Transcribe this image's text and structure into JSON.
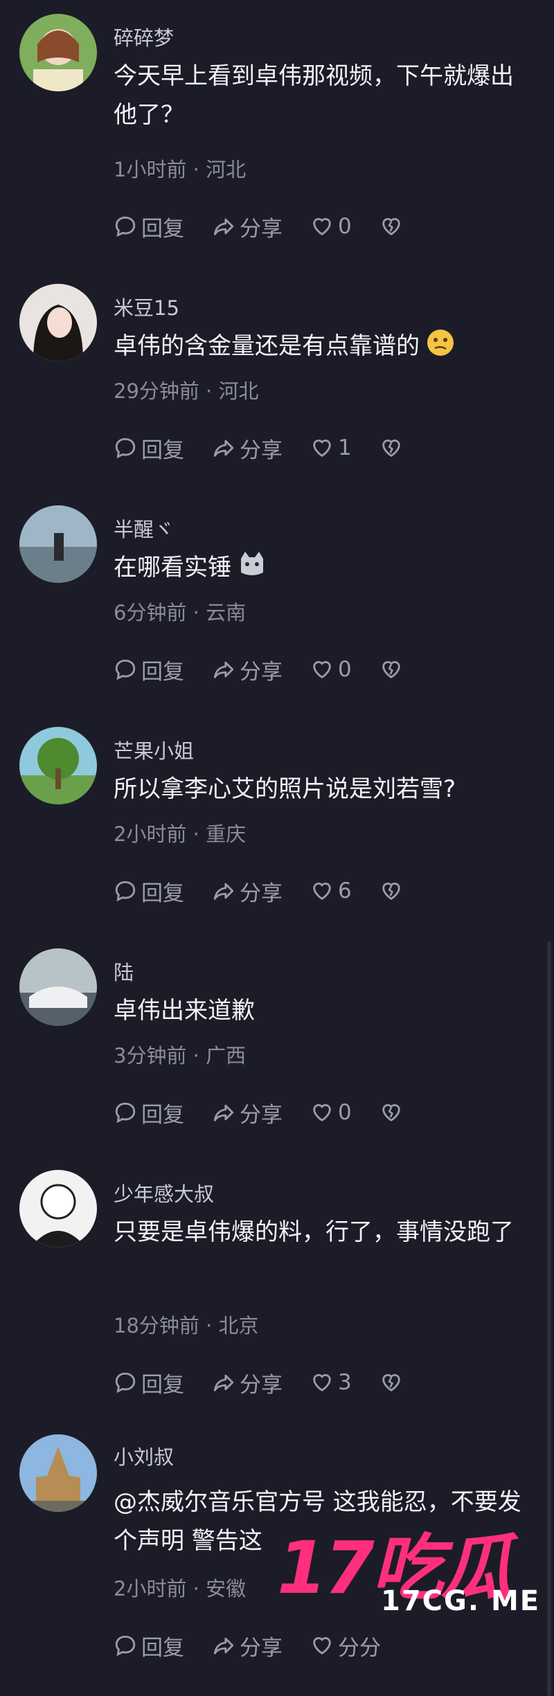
{
  "comments": [
    {
      "username": "碎碎梦",
      "text": "今天早上看到卓伟那视频，下午就爆出他了？",
      "meta": "1小时前 · 河北",
      "reply": "回复",
      "share": "分享",
      "likes": "0"
    },
    {
      "username": "米豆15",
      "text": "卓伟的含金量还是有点靠谱的",
      "meta": "29分钟前 · 河北",
      "reply": "回复",
      "share": "分享",
      "likes": "1",
      "emoji": "thinking-face-emoji"
    },
    {
      "username": "半醒ヾ",
      "text": "在哪看实锤",
      "meta": "6分钟前 · 云南",
      "reply": "回复",
      "share": "分享",
      "likes": "0",
      "emoji": "cat-face-emoji"
    },
    {
      "username": "芒果小姐",
      "text": "所以拿李心艾的照片说是刘若雪?",
      "meta": "2小时前 · 重庆",
      "reply": "回复",
      "share": "分享",
      "likes": "6"
    },
    {
      "username": "陆",
      "text": "卓伟出来道歉",
      "meta": "3分钟前 · 广西",
      "reply": "回复",
      "share": "分享",
      "likes": "0"
    },
    {
      "username": "少年感大叔",
      "text": "只要是卓伟爆的料，行了，事情没跑了",
      "meta": "18分钟前 · 北京",
      "reply": "回复",
      "share": "分享",
      "likes": "3"
    },
    {
      "username": "小刘叔",
      "text": "@杰威尔音乐官方号 这我能忍，不要发个声明 警告这",
      "meta": "2小时前 · 安徽",
      "reply": "回复",
      "share": "分享",
      "likes": "分分"
    }
  ],
  "watermark": {
    "brand": "17吃瓜",
    "site": "17CG. ME"
  }
}
